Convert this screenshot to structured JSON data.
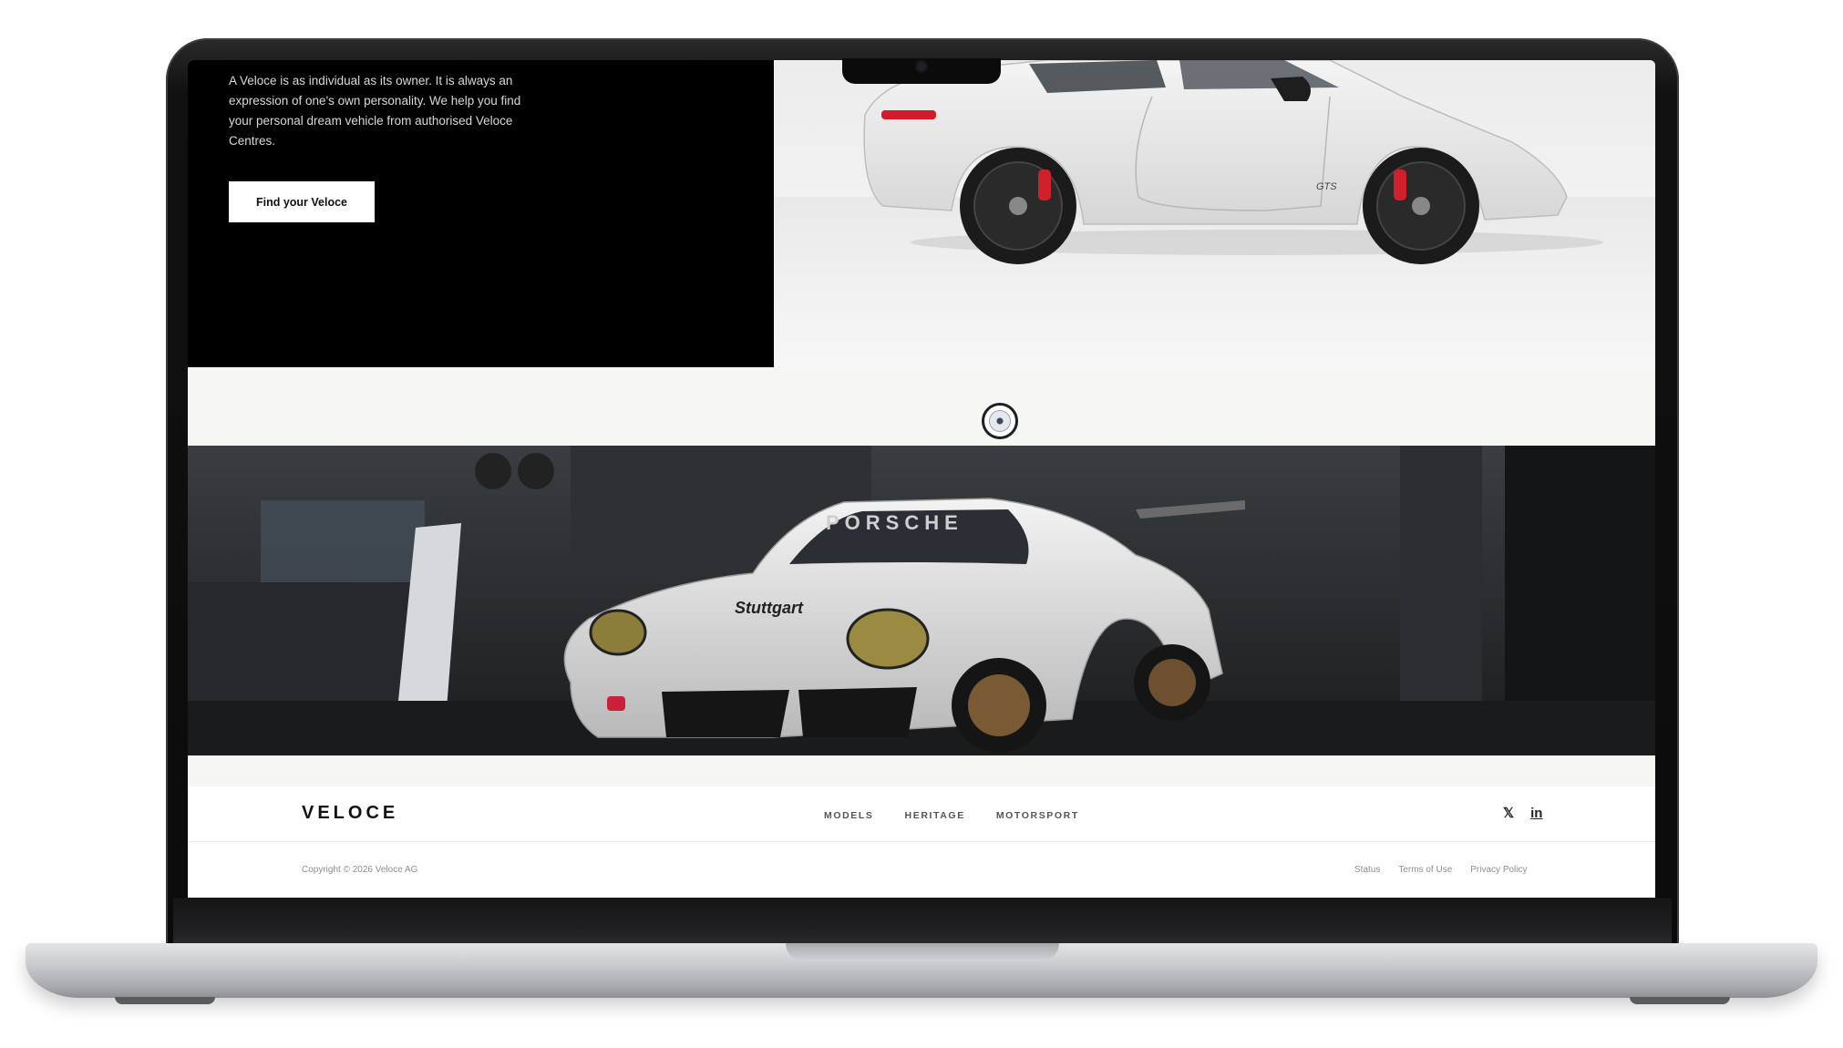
{
  "hero": {
    "description": "A Veloce is as individual as its owner. It is always an expression of one's own personality. We help you find your personal dream vehicle from authorised Veloce Centres.",
    "cta_label": "Find your Veloce"
  },
  "race_car": {
    "windscreen_text": "PORSCHE",
    "hood_text": "Stuttgart"
  },
  "hero_car": {
    "badge_text": "GTS"
  },
  "footer": {
    "brand": "VELOCE",
    "nav": [
      {
        "label": "MODELS"
      },
      {
        "label": "HERITAGE"
      },
      {
        "label": "MOTORSPORT"
      }
    ],
    "social": {
      "x": "𝕏",
      "linkedin": "in"
    },
    "copyright": "Copyright © 2026 Veloce AG",
    "legal": [
      {
        "label": "Status"
      },
      {
        "label": "Terms of Use"
      },
      {
        "label": "Privacy Policy"
      }
    ]
  },
  "icons": {
    "scroll_indicator": "scroll-indicator-icon",
    "x": "x-icon",
    "linkedin": "linkedin-icon"
  }
}
